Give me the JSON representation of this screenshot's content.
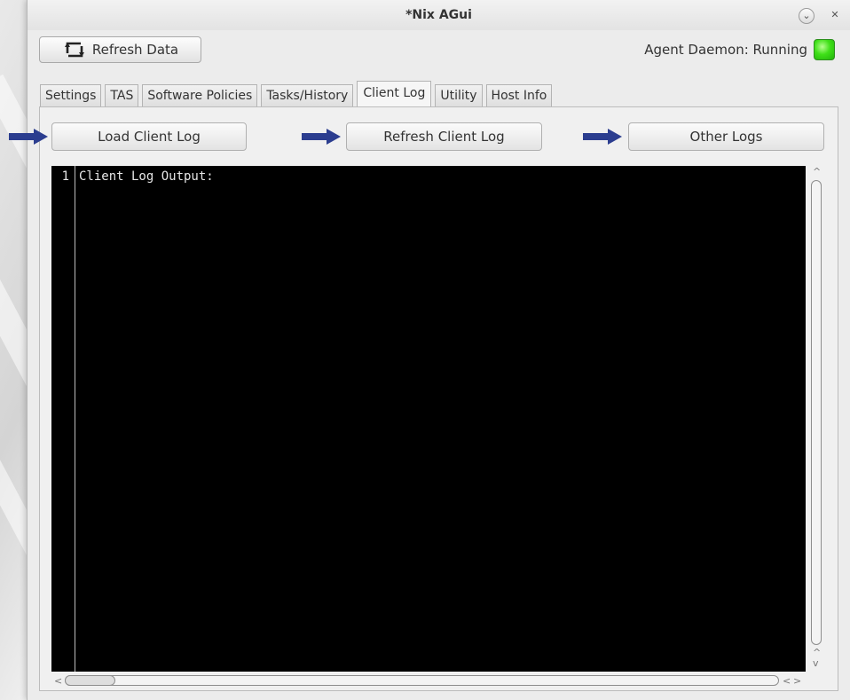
{
  "window": {
    "title": "*Nix AGui"
  },
  "titlebar": {
    "minimize_glyph": "⌄",
    "close_glyph": "✕"
  },
  "toolbar": {
    "refresh_label": "Refresh Data"
  },
  "status": {
    "daemon_text": "Agent Daemon: Running",
    "indicator_color": "#33d911"
  },
  "tabs": [
    {
      "label": "Settings"
    },
    {
      "label": "TAS"
    },
    {
      "label": "Software Policies"
    },
    {
      "label": "Tasks/History"
    },
    {
      "label": "Client Log"
    },
    {
      "label": "Utility"
    },
    {
      "label": "Host Info"
    }
  ],
  "active_tab": "Client Log",
  "actions": {
    "load_label": "Load Client Log",
    "refresh_label": "Refresh Client Log",
    "other_label": "Other Logs"
  },
  "editor": {
    "line_numbers": [
      "1"
    ],
    "lines": [
      "Client Log Output:"
    ]
  },
  "colors": {
    "arrow": "#2b3d8f",
    "editor_bg": "#000000"
  },
  "icons": {
    "refresh": "refresh-icon",
    "minimize": "chevron-down-icon",
    "close": "close-icon",
    "arrow": "arrow-right-icon"
  }
}
